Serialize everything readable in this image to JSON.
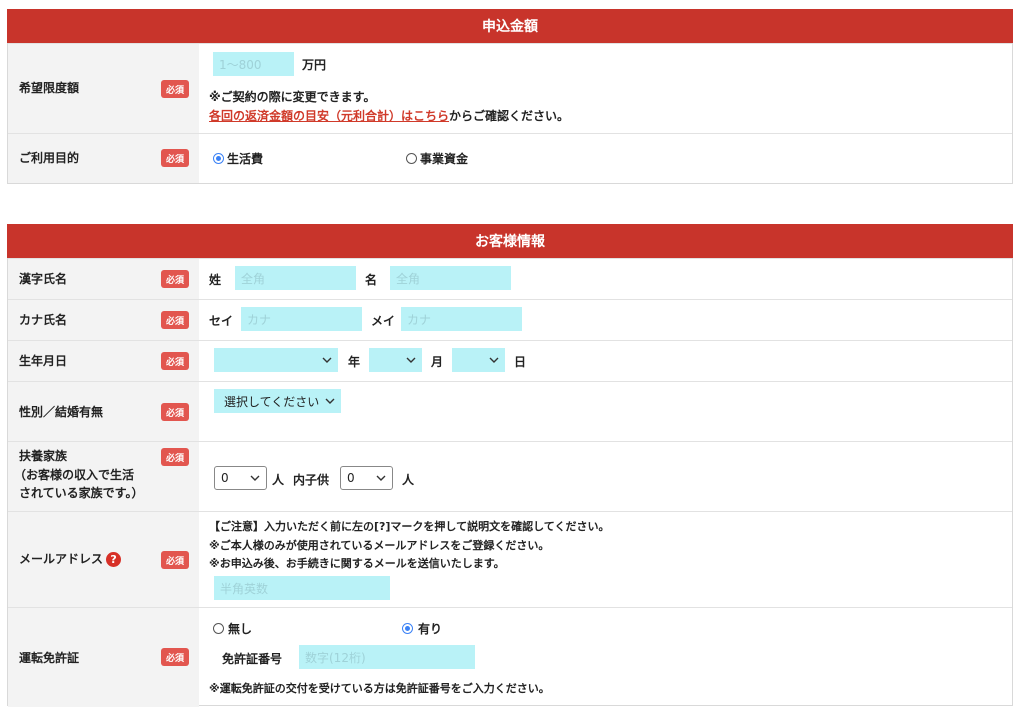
{
  "section1": {
    "title": "申込金額",
    "limit": {
      "label": "希望限度額",
      "required": "必須",
      "placeholder": "1〜800",
      "unit": "万円",
      "note": "※ご契約の際に変更できます。",
      "link": "各回の返済金額の目安（元利合計）はこちら",
      "link_suffix": "からご確認ください。"
    },
    "purpose": {
      "label": "ご利用目的",
      "required": "必須",
      "option1": "生活費",
      "option2": "事業資金",
      "selected": "生活費"
    }
  },
  "section2": {
    "title": "お客様情報",
    "kanji": {
      "label": "漢字氏名",
      "required": "必須",
      "sei": "姓",
      "mei": "名",
      "sei_placeholder": "全角",
      "mei_placeholder": "全角"
    },
    "kana": {
      "label": "カナ氏名",
      "required": "必須",
      "sei": "セイ",
      "mei": "メイ",
      "sei_placeholder": "カナ",
      "mei_placeholder": "カナ"
    },
    "birth": {
      "label": "生年月日",
      "required": "必須",
      "year": "年",
      "month": "月",
      "day": "日"
    },
    "gender": {
      "label": "性別／結婚有無",
      "required": "必須",
      "select": "選択してください"
    },
    "family": {
      "label_line1": "扶養家族",
      "label_line2": "（お客様の収入で生活",
      "label_line3": "されている家族です。）",
      "required": "必須",
      "count1": "0",
      "unit1": "人",
      "child_label": "内子供",
      "count2": "0",
      "unit2": "人"
    },
    "email": {
      "label": "メールアドレス",
      "help": "?",
      "required": "必須",
      "note1": "【ご注意】入力いただく前に左の[?]マークを押して説明文を確認してください。",
      "note2": "※ご本人様のみが使用されているメールアドレスをご登録ください。",
      "note3": "※お申込み後、お手続きに関するメールを送信いたします。",
      "placeholder": "半角英数"
    },
    "license": {
      "label": "運転免許証",
      "required": "必須",
      "option_no": "無し",
      "option_yes": "有り",
      "selected": "有り",
      "number_label": "免許証番号",
      "number_placeholder": "数字(12桁)",
      "note": "※運転免許証の交付を受けている方は免許証番号をご入力ください。"
    }
  },
  "colors": {
    "header": "#c8342b",
    "input_bg": "#b9f2f7",
    "required_badge": "#e2564f",
    "link": "#d03a2a",
    "radio_on": "#3b82f6"
  }
}
